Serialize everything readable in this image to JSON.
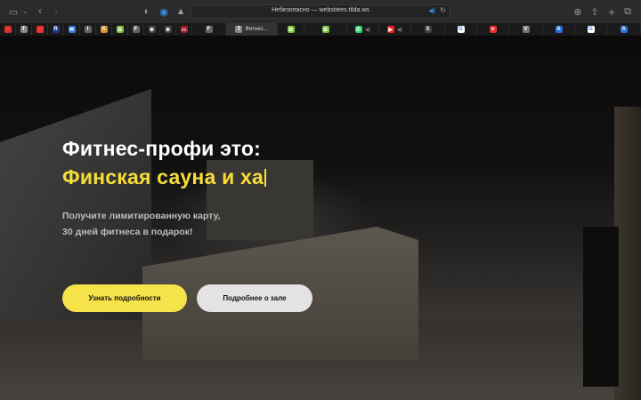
{
  "browser": {
    "url_text": "Небезопасно — websitees.tilda.ws",
    "active_tab_title": "Фитнес...",
    "tabs": [
      {
        "icon": "russia-flag-icon",
        "color": "#d33"
      },
      {
        "icon": "tilda-icon",
        "color": "#888",
        "glyph": "T"
      },
      {
        "icon": "red-dot-icon",
        "color": "#e33"
      },
      {
        "icon": "r-icon",
        "color": "#223a8a",
        "glyph": "R"
      },
      {
        "icon": "mail-icon",
        "color": "#3a7bd5",
        "glyph": "✉"
      },
      {
        "icon": "i-icon",
        "color": "#666",
        "glyph": "I"
      },
      {
        "icon": "x-icon",
        "color": "#d8952a",
        "glyph": "X"
      },
      {
        "icon": "leaf-icon",
        "color": "#7bc242",
        "glyph": "✿"
      },
      {
        "icon": "f-icon",
        "color": "#666",
        "glyph": "F"
      },
      {
        "icon": "openai-icon",
        "color": "#444",
        "glyph": "⊛"
      },
      {
        "icon": "openai-icon",
        "color": "#444",
        "glyph": "⊛"
      },
      {
        "icon": "red-rect-icon",
        "color": "#a01a2a",
        "glyph": "▭"
      },
      {
        "icon": "f-icon",
        "color": "#666",
        "glyph": "F"
      },
      {
        "icon": "tilda-icon",
        "color": "#888",
        "glyph": "T",
        "title": "Фитнес..."
      },
      {
        "icon": "leaf-icon",
        "color": "#7bc242",
        "glyph": "✿"
      },
      {
        "icon": "leaf-icon",
        "color": "#7bc242",
        "glyph": "✿"
      },
      {
        "icon": "whatsapp-icon",
        "color": "#25d366",
        "glyph": "✆",
        "speaker": true
      },
      {
        "icon": "youtube-icon",
        "color": "#e22",
        "glyph": "▶",
        "speaker": true
      },
      {
        "icon": "s-icon",
        "color": "#444",
        "glyph": "S"
      },
      {
        "icon": "google-icon",
        "color": "#fff",
        "glyph": "G"
      },
      {
        "icon": "red-circle-icon",
        "color": "#e33",
        "glyph": "●"
      },
      {
        "icon": "v-icon",
        "color": "#777",
        "glyph": "V"
      },
      {
        "icon": "blue-a-icon",
        "color": "#2a6fd8",
        "glyph": "A"
      },
      {
        "icon": "google-icon",
        "color": "#fff",
        "glyph": "G"
      },
      {
        "icon": "blue-a-icon",
        "color": "#2a6fd8",
        "glyph": "A"
      }
    ]
  },
  "hero": {
    "title_line1": "Фитнес-профи это:",
    "title_line2": "Финская сауна и ха",
    "subtitle_line1": "Получите лимитированную карту,",
    "subtitle_line2": "30 дней фитнеса в подарок!",
    "primary_button": "Узнать подробности",
    "secondary_button": "Подробнее о зале"
  },
  "colors": {
    "accent": "#f7dd3a",
    "primary_button": "#f6e34a",
    "secondary_button": "#e3e3e3"
  }
}
